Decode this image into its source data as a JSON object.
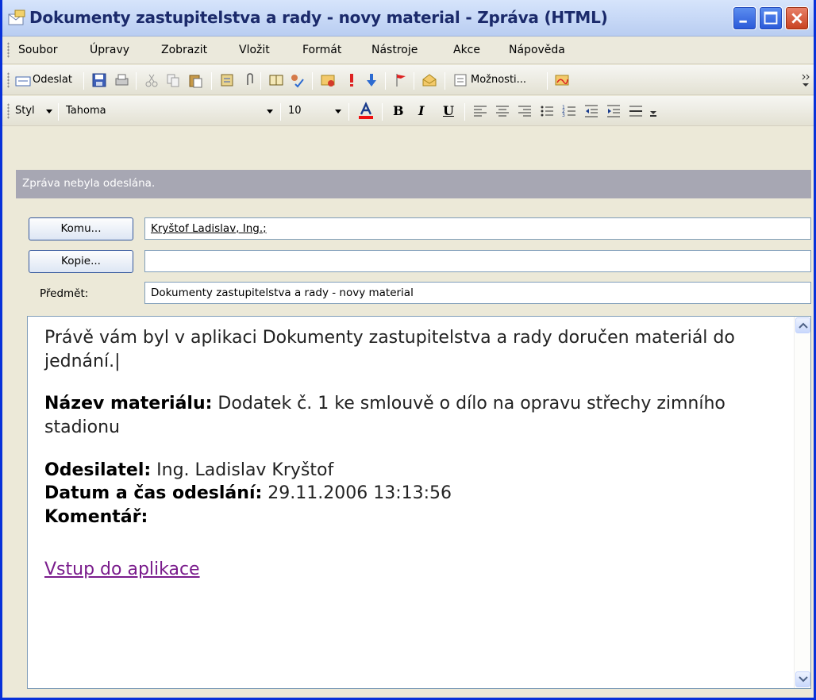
{
  "window": {
    "title": "Dokumenty zastupitelstva a rady - novy material - Zpráva (HTML)"
  },
  "menu": {
    "items": [
      "Soubor",
      "Úpravy",
      "Zobrazit",
      "Vložit",
      "Formát",
      "Nástroje",
      "Akce",
      "Nápověda"
    ]
  },
  "toolbar1": {
    "send_label": "Odeslat",
    "options_label": "Možnosti..."
  },
  "toolbar2": {
    "style_label": "Styl",
    "font_value": "Tahoma",
    "size_value": "10",
    "bold": "B",
    "italic": "I",
    "underline": "U"
  },
  "banner": {
    "text": "Zpráva nebyla odeslána."
  },
  "fields": {
    "to_button": "Komu...",
    "to_value": "Kryštof Ladislav, Ing.;",
    "cc_button": "Kopie...",
    "cc_value": "",
    "subject_label": "Předmět:",
    "subject_value": "Dokumenty zastupitelstva a rady - novy material"
  },
  "body": {
    "intro": "Právě vám byl v aplikaci Dokumenty zastupitelstva a rady doručen materiál do jednání.|",
    "material_label": "Název materiálu:",
    "material_value": " Dodatek č. 1 ke smlouvě o dílo na opravu střechy zimního stadionu",
    "sender_label": "Odesilatel:",
    "sender_value": " Ing. Ladislav Kryštof",
    "date_label": "Datum a čas odeslání:",
    "date_value": " 29.11.2006 13:13:56",
    "comment_label": "Komentář:",
    "link_text": "Vstup do aplikace"
  },
  "colors": {
    "title_text": "#1b2a6b",
    "banner_bg": "#a7a7b3",
    "link": "#7a1c8c"
  }
}
